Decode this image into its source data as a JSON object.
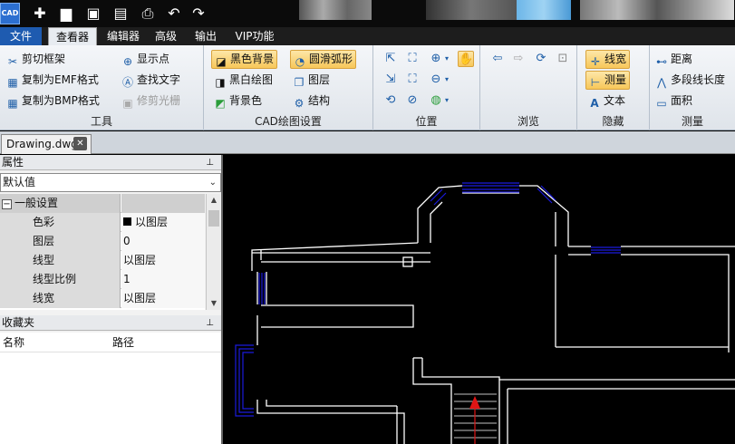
{
  "app": {
    "icon_text": "CAD"
  },
  "menu": {
    "tabs": [
      "文件",
      "查看器",
      "编辑器",
      "高级",
      "输出",
      "VIP功能"
    ]
  },
  "ribbon": {
    "tools": {
      "label": "工具",
      "items": [
        "剪切框架",
        "复制为EMF格式",
        "复制为BMP格式",
        "显示点",
        "查找文字",
        "修剪光栅"
      ]
    },
    "cad": {
      "label": "CAD绘图设置",
      "items": [
        "黑色背景",
        "黑白绘图",
        "背景色",
        "圆滑弧形",
        "图层",
        "结构"
      ]
    },
    "position": {
      "label": "位置"
    },
    "browse": {
      "label": "浏览"
    },
    "hide": {
      "label": "隐藏",
      "items": [
        "线宽",
        "测量",
        "文本"
      ]
    },
    "measure": {
      "label": "测量",
      "items": [
        "距离",
        "多段线长度",
        "面积"
      ]
    }
  },
  "document": {
    "tab": "Drawing.dwg"
  },
  "properties": {
    "title": "属性",
    "selector": "默认值",
    "category": "一般设置",
    "rows": [
      {
        "k": "色彩",
        "v": "以图层"
      },
      {
        "k": "图层",
        "v": "0"
      },
      {
        "k": "线型",
        "v": "以图层"
      },
      {
        "k": "线型比例",
        "v": "1"
      },
      {
        "k": "线宽",
        "v": "以图层"
      }
    ]
  },
  "favorites": {
    "title": "收藏夹",
    "cols": [
      "名称",
      "路径"
    ]
  },
  "colors": {
    "accent": "#1e5bb0",
    "canvas_bg": "#000000",
    "wall": "#ffffff",
    "window": "#1a1adc",
    "stair_arrow": "#e01515"
  }
}
